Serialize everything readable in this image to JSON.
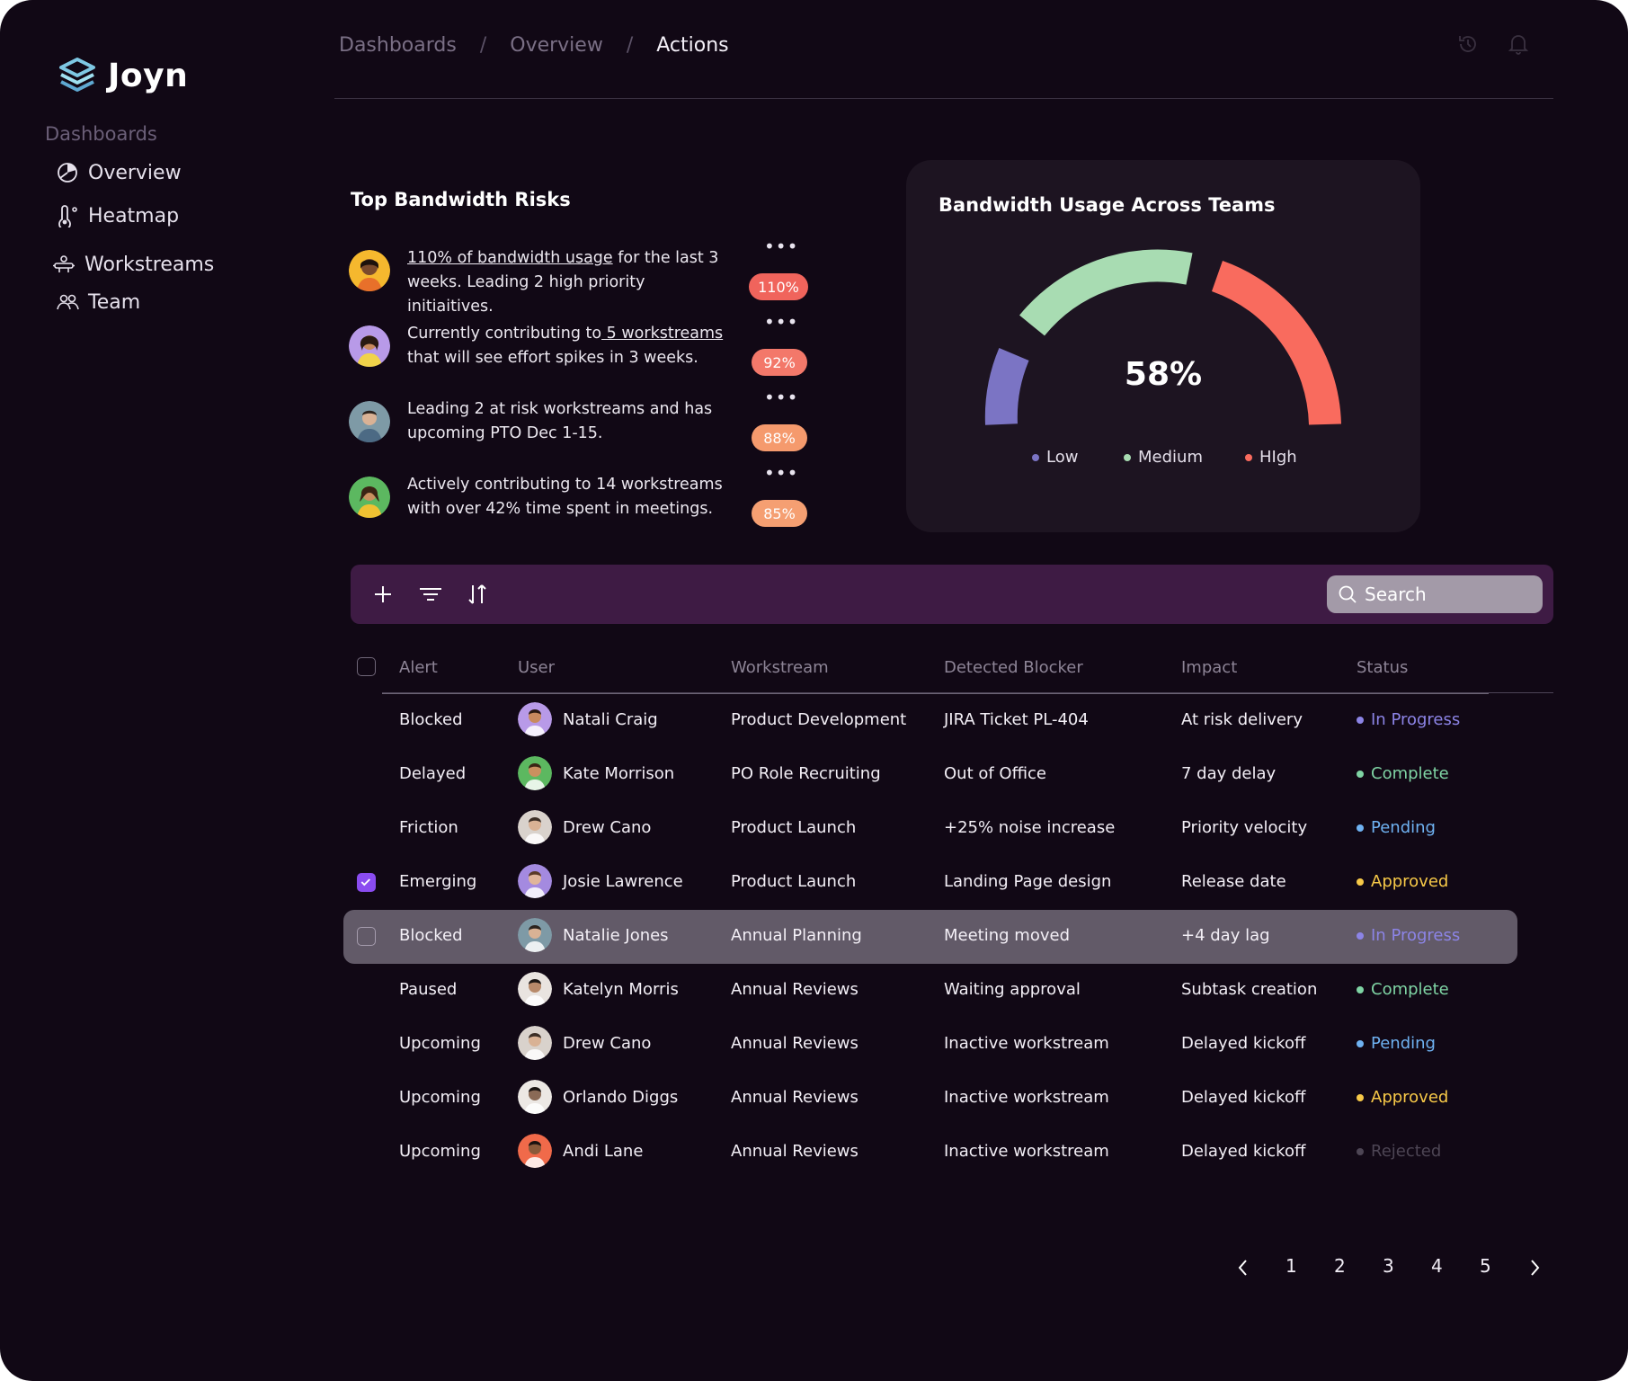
{
  "brand": {
    "name": "Joyn"
  },
  "sidebar": {
    "heading": "Dashboards",
    "items": [
      {
        "label": "Overview",
        "icon": "pie-chart-icon"
      },
      {
        "label": "Heatmap",
        "icon": "thermometer-icon"
      },
      {
        "label": "Workstreams",
        "icon": "workstream-icon"
      },
      {
        "label": "Team",
        "icon": "team-icon"
      }
    ]
  },
  "breadcrumb": {
    "items": [
      "Dashboards",
      "Overview",
      "Actions"
    ],
    "separator": "/"
  },
  "risks": {
    "title": "Top Bandwidth Risks",
    "items": [
      {
        "link": "110% of bandwidth usage",
        "text": " for the last 3 weeks. Leading 2 high priority initiaitives.",
        "badge": "110%",
        "badge_color": "#f0645c",
        "more": "•••"
      },
      {
        "prefix": "Currently contributing to",
        "link": " 5 workstreams",
        "text": " that will see effort spikes in 3 weeks.",
        "badge": "92%",
        "badge_color": "#f3786a",
        "more": "•••"
      },
      {
        "text": "Leading 2 at risk workstreams and has upcoming PTO Dec 1-15.",
        "badge": "88%",
        "badge_color": "#f59a6d",
        "more": "•••"
      },
      {
        "text": "Actively contributing to 14 workstreams with over 42% time spent in meetings.",
        "badge": "85%",
        "badge_color": "#f59f72",
        "more": "•••"
      }
    ]
  },
  "gauge": {
    "title": "Bandwidth Usage Across Teams",
    "value": 58,
    "value_label": "58%",
    "segments": [
      {
        "name": "Low",
        "color": "#7b74c4"
      },
      {
        "name": "Medium",
        "color": "#a8dcb2"
      },
      {
        "name": "HIgh",
        "color": "#f96b5e"
      }
    ]
  },
  "toolbar": {
    "search_placeholder": "Search"
  },
  "table": {
    "columns": [
      "Alert",
      "User",
      "Workstream",
      "Detected Blocker",
      "Impact",
      "Status"
    ],
    "rows": [
      {
        "alert": "Blocked",
        "user": "Natali Craig",
        "workstream": "Product Development",
        "blocker": "JIRA Ticket PL-404",
        "impact": "At risk delivery",
        "status": "In Progress"
      },
      {
        "alert": "Delayed",
        "user": "Kate Morrison",
        "workstream": "PO Role Recruiting",
        "blocker": "Out of Office",
        "impact": "7 day delay",
        "status": "Complete"
      },
      {
        "alert": "Friction",
        "user": "Drew Cano",
        "workstream": "Product Launch",
        "blocker": "+25% noise increase",
        "impact": "Priority velocity",
        "status": "Pending"
      },
      {
        "alert": "Emerging",
        "user": "Josie Lawrence",
        "workstream": "Product Launch",
        "blocker": "Landing Page design",
        "impact": "Release date",
        "status": "Approved"
      },
      {
        "alert": "Blocked",
        "user": "Natalie Jones",
        "workstream": "Annual Planning",
        "blocker": "Meeting moved",
        "impact": "+4 day lag",
        "status": "In Progress"
      },
      {
        "alert": "Paused",
        "user": "Katelyn Morris",
        "workstream": "Annual Reviews",
        "blocker": "Waiting approval",
        "impact": "Subtask creation",
        "status": "Complete"
      },
      {
        "alert": "Upcoming",
        "user": "Drew Cano",
        "workstream": "Annual Reviews",
        "blocker": "Inactive workstream",
        "impact": "Delayed kickoff",
        "status": "Pending"
      },
      {
        "alert": "Upcoming",
        "user": "Orlando Diggs",
        "workstream": "Annual Reviews",
        "blocker": "Inactive workstream",
        "impact": "Delayed kickoff",
        "status": "Approved"
      },
      {
        "alert": "Upcoming",
        "user": "Andi Lane",
        "workstream": "Annual Reviews",
        "blocker": "Inactive workstream",
        "impact": "Delayed kickoff",
        "status": "Rejected"
      }
    ],
    "status_colors": {
      "In Progress": "#8c84e6",
      "Complete": "#7fd4a4",
      "Pending": "#6fb2f2",
      "Approved": "#f7c948",
      "Rejected": "#4d4554"
    }
  },
  "pagination": {
    "pages": [
      "1",
      "2",
      "3",
      "4",
      "5"
    ]
  }
}
